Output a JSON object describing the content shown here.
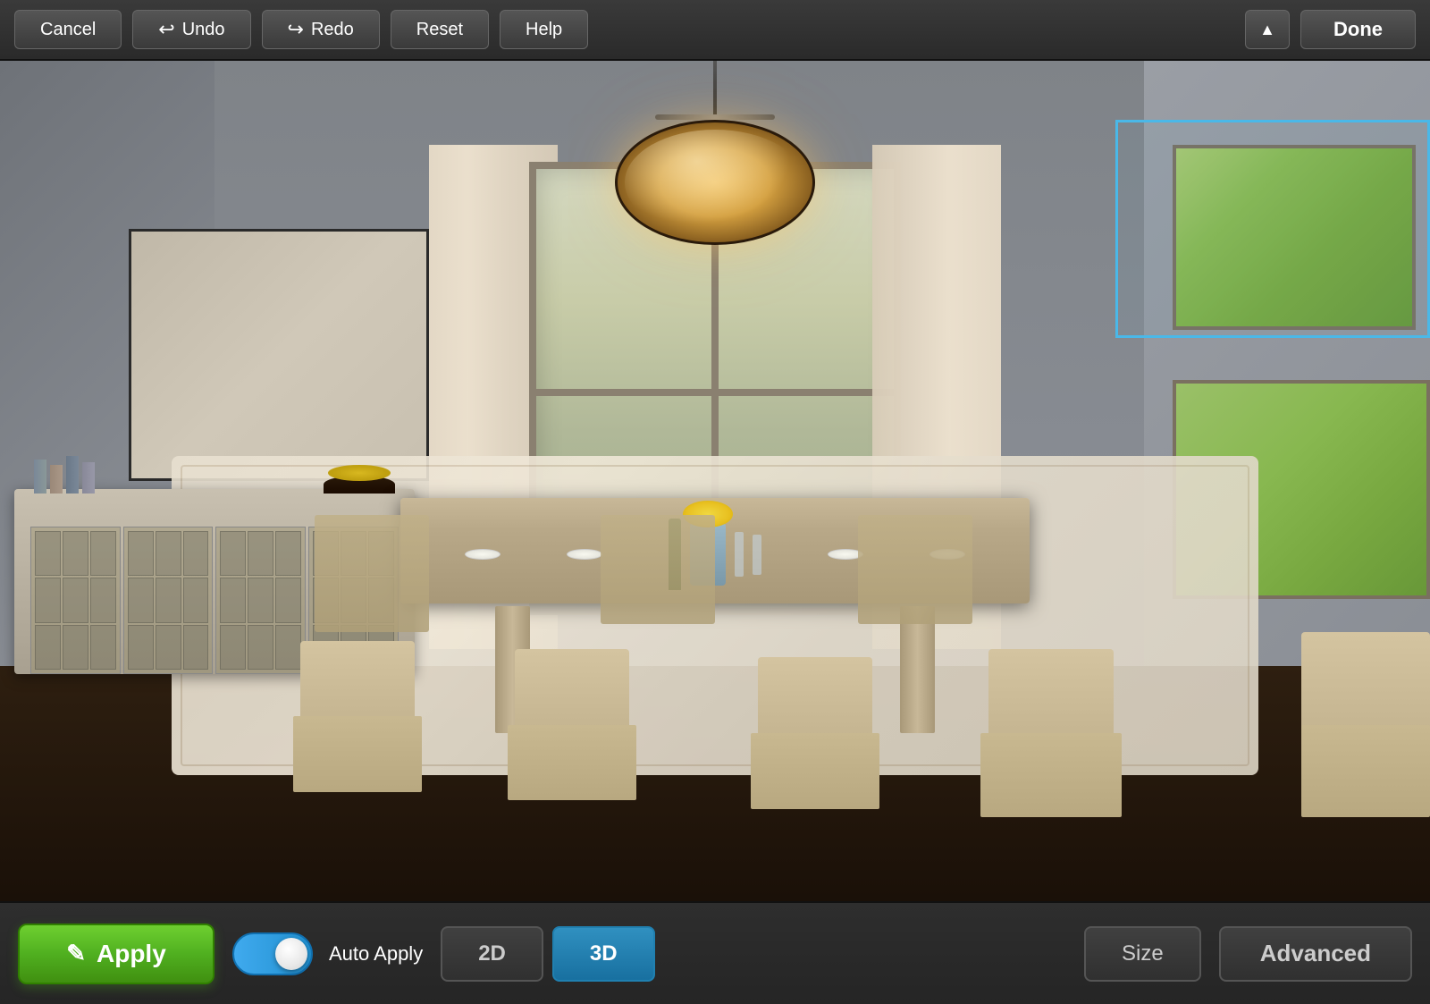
{
  "toolbar": {
    "cancel_label": "Cancel",
    "undo_label": "Undo",
    "redo_label": "Redo",
    "reset_label": "Reset",
    "help_label": "Help",
    "done_label": "Done",
    "collapse_icon": "▲"
  },
  "bottom_toolbar": {
    "apply_label": "Apply",
    "apply_icon": "✏",
    "auto_apply_label": "Auto Apply",
    "view_2d_label": "2D",
    "view_3d_label": "3D",
    "size_label": "Size",
    "advanced_label": "Advanced"
  },
  "icons": {
    "undo_arrow": "↩",
    "redo_arrow": "↪",
    "pencil": "✎"
  }
}
